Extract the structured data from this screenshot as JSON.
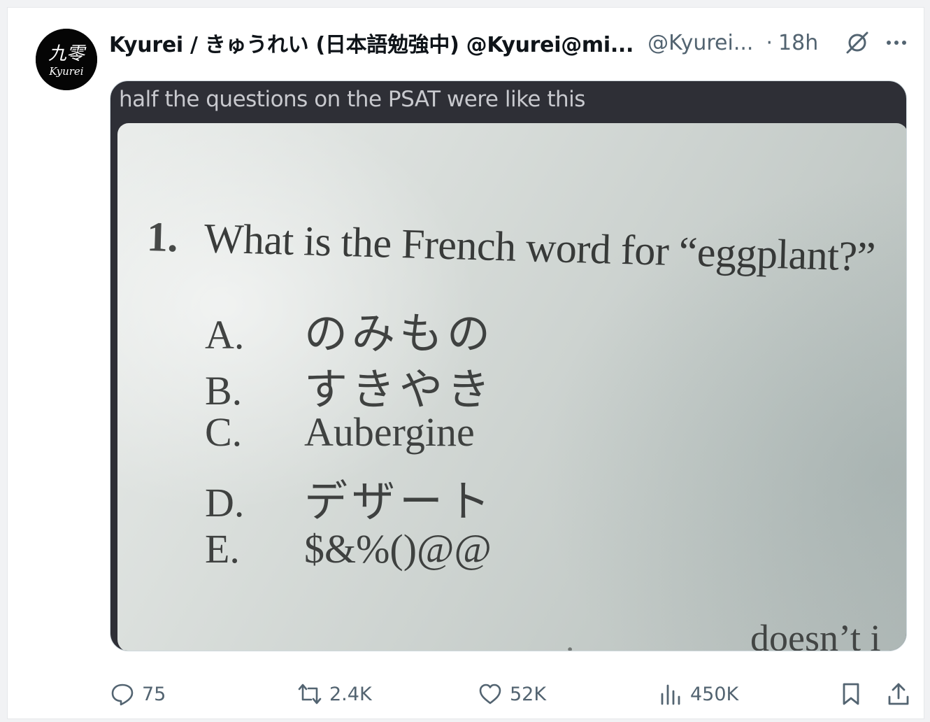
{
  "post": {
    "display_name": "Kyurei / きゅうれい (日本語勉強中) @Kyurei@mi...",
    "handle": "@Kyurei...",
    "separator": "·",
    "time": "18h",
    "avatar": {
      "kanji": "九零",
      "romaji": "Kyurei"
    }
  },
  "media": {
    "caption": "half the questions on the PSAT were like this",
    "question": {
      "number": "1.",
      "text": "What is the French word for “eggplant?”"
    },
    "options": [
      {
        "letter": "A.",
        "text": "のみもの"
      },
      {
        "letter": "B.",
        "text": "すきやき"
      },
      {
        "letter": "C.",
        "text": "Aubergine"
      },
      {
        "letter": "D.",
        "text": "デザート"
      },
      {
        "letter": "E.",
        "text": "$&%()@@"
      }
    ],
    "cut_text": "doesn’t i",
    "cut_text_faint": "ior"
  },
  "actions": {
    "replies": "75",
    "reposts": "2.4K",
    "likes": "52K",
    "views": "450K"
  },
  "colors": {
    "text_primary": "#0f1419",
    "text_secondary": "#536471",
    "media_frame": "#2e2f36"
  },
  "icons": [
    "grok-icon",
    "more-icon",
    "reply-icon",
    "repost-icon",
    "like-icon",
    "views-icon",
    "bookmark-icon",
    "share-icon"
  ]
}
